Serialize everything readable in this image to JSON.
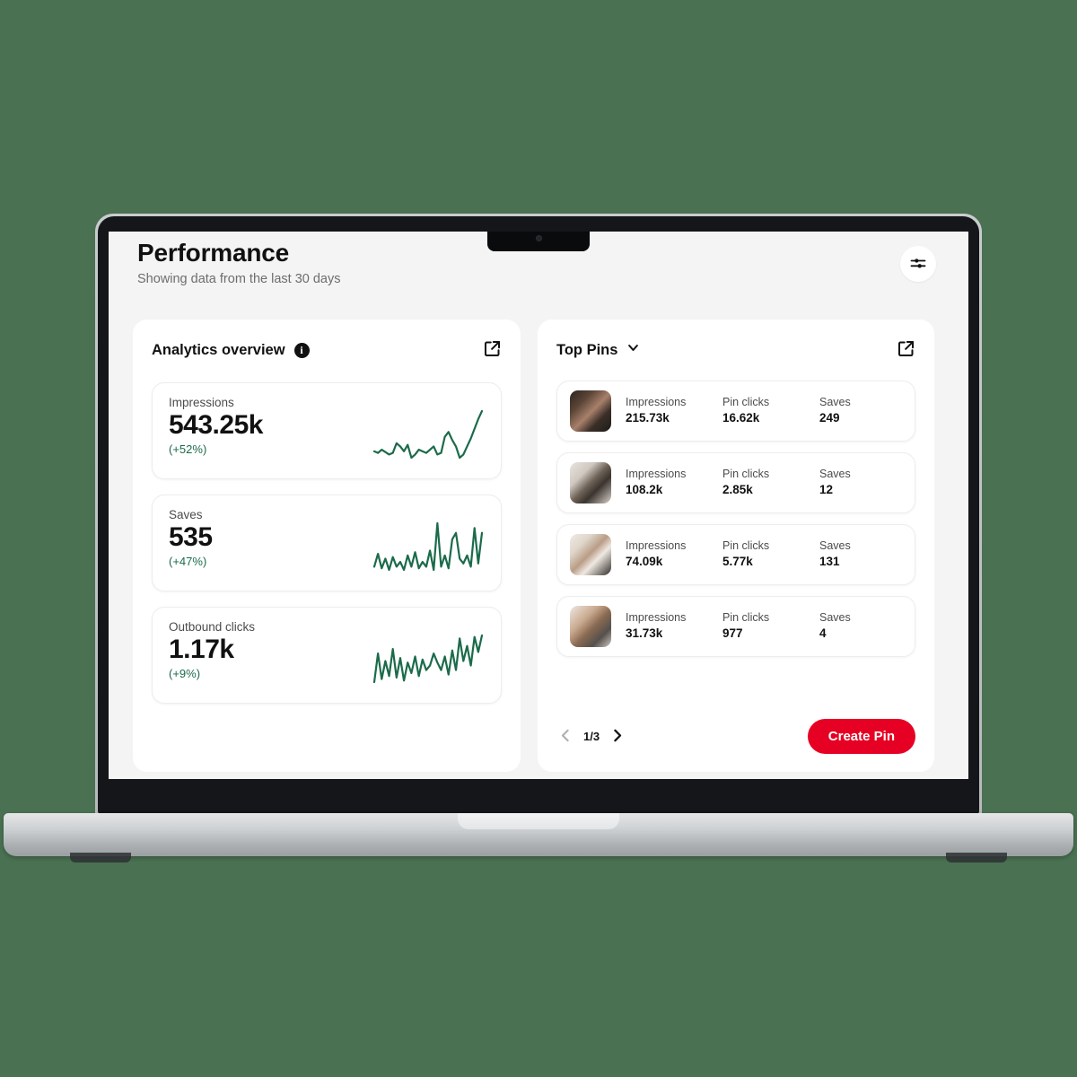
{
  "header": {
    "title": "Performance",
    "subtitle": "Showing data from the last 30 days",
    "settings_icon": "sliders-icon"
  },
  "analytics_panel": {
    "title": "Analytics overview",
    "info_icon": "info-icon",
    "info_glyph": "i",
    "expand_icon": "external-link-icon",
    "metrics": [
      {
        "label": "Impressions",
        "value": "543.25k",
        "delta": "(+52%)"
      },
      {
        "label": "Saves",
        "value": "535",
        "delta": "(+47%)"
      },
      {
        "label": "Outbound clicks",
        "value": "1.17k",
        "delta": "(+9%)"
      }
    ]
  },
  "top_pins_panel": {
    "title": "Top Pins",
    "chevron_icon": "chevron-down-icon",
    "expand_icon": "external-link-icon",
    "columns": [
      "Impressions",
      "Pin clicks",
      "Saves"
    ],
    "rows": [
      {
        "thumb": "pin-thumbnail-1",
        "impressions": "215.73k",
        "pin_clicks": "16.62k",
        "saves": "249"
      },
      {
        "thumb": "pin-thumbnail-2",
        "impressions": "108.2k",
        "pin_clicks": "2.85k",
        "saves": "12"
      },
      {
        "thumb": "pin-thumbnail-3",
        "impressions": "74.09k",
        "pin_clicks": "5.77k",
        "saves": "131"
      },
      {
        "thumb": "pin-thumbnail-4",
        "impressions": "31.73k",
        "pin_clicks": "977",
        "saves": "4"
      }
    ],
    "pagination": {
      "count": "1/3",
      "prev_icon": "chevron-left-icon",
      "next_icon": "chevron-right-icon"
    },
    "create_pin_label": "Create Pin"
  },
  "colors": {
    "background": "#4a7152",
    "page": "#f4f4f4",
    "panel": "#ffffff",
    "accent_red": "#e60023",
    "spark_green": "#1b6b4a",
    "text": "#111111",
    "muted": "#6d6d6d"
  },
  "chart_data": [
    {
      "type": "line",
      "title": "Impressions",
      "ylabel": "",
      "xlabel": "",
      "legend": "none",
      "grid": false,
      "values": [
        38,
        36,
        40,
        37,
        34,
        36,
        48,
        44,
        38,
        46,
        30,
        34,
        40,
        38,
        36,
        40,
        44,
        34,
        36,
        56,
        62,
        52,
        44,
        30,
        34,
        44,
        54,
        66,
        78,
        88
      ]
    },
    {
      "type": "line",
      "title": "Saves",
      "ylabel": "",
      "xlabel": "",
      "legend": "none",
      "grid": false,
      "values": [
        30,
        46,
        28,
        40,
        26,
        42,
        30,
        36,
        26,
        44,
        30,
        48,
        28,
        36,
        30,
        50,
        26,
        84,
        30,
        44,
        28,
        64,
        72,
        40,
        34,
        44,
        30,
        78,
        34,
        72
      ]
    },
    {
      "type": "line",
      "title": "Outbound clicks",
      "ylabel": "",
      "xlabel": "",
      "legend": "none",
      "grid": false,
      "values": [
        18,
        56,
        22,
        46,
        26,
        62,
        24,
        50,
        20,
        44,
        30,
        52,
        26,
        48,
        34,
        40,
        56,
        44,
        34,
        52,
        28,
        60,
        34,
        76,
        46,
        66,
        40,
        78,
        58,
        80
      ]
    }
  ]
}
